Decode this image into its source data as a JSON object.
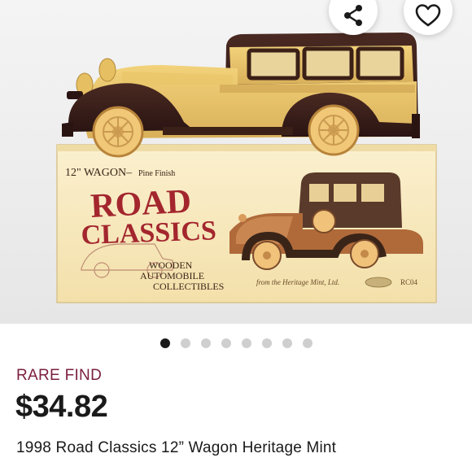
{
  "listing": {
    "badge": "RARE FIND",
    "price": "$34.82",
    "title": "1998 Road Classics 12” Wagon Heritage Mint"
  },
  "gallery": {
    "total_images": 8,
    "active_index": 0,
    "box_label_top": "12\" WAGON–",
    "box_label_finish": "Pine Finish",
    "box_brand_line1": "ROAD",
    "box_brand_line2": "CLASSICS",
    "box_sub_line1": "WOODEN",
    "box_sub_line2": "AUTOMOBILE",
    "box_sub_line3": "COLLECTIBLES",
    "box_maker": "from the Heritage Mint, Ltd.",
    "box_code": "RC04"
  },
  "actions": {
    "share_icon": "share-icon",
    "like_icon": "heart-icon"
  },
  "colors": {
    "badge": "#7a1f3d",
    "dot_active": "#1a1a1a",
    "dot_inactive": "#cfcfcf",
    "box_brand": "#a3262e"
  }
}
